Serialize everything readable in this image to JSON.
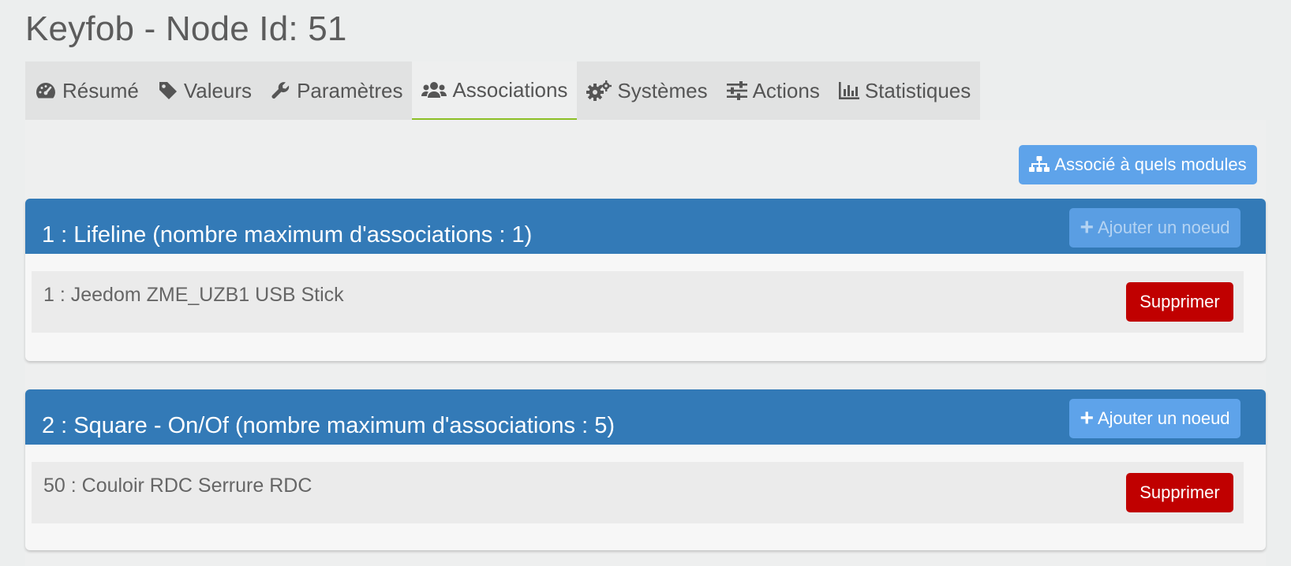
{
  "page_title": "Keyfob - Node Id: 51",
  "tabs": [
    {
      "label": "Résumé",
      "icon": "dashboard-icon"
    },
    {
      "label": "Valeurs",
      "icon": "tag-icon"
    },
    {
      "label": "Paramètres",
      "icon": "wrench-icon"
    },
    {
      "label": "Associations",
      "icon": "users-icon",
      "active": true
    },
    {
      "label": "Systèmes",
      "icon": "cogs-icon"
    },
    {
      "label": "Actions",
      "icon": "sliders-icon"
    },
    {
      "label": "Statistiques",
      "icon": "bar-chart-icon"
    }
  ],
  "associated_modules_button": "Associé à quels modules",
  "groups": [
    {
      "title": "1 : Lifeline (nombre maximum d'associations : 1)",
      "add_label": "Ajouter un noeud",
      "add_disabled": true,
      "nodes": [
        {
          "label": "1 : Jeedom ZME_UZB1 USB Stick",
          "delete_label": "Supprimer"
        }
      ]
    },
    {
      "title": "2 : Square - On/Of (nombre maximum d'associations : 5)",
      "add_label": "Ajouter un noeud",
      "add_disabled": false,
      "nodes": [
        {
          "label": "50 : Couloir RDC Serrure RDC",
          "delete_label": "Supprimer"
        }
      ]
    }
  ],
  "colors": {
    "panel_header": "#337ab7",
    "button_primary": "#5ea3ea",
    "button_danger": "#c00000",
    "active_tab_underline": "#8cbf26"
  }
}
